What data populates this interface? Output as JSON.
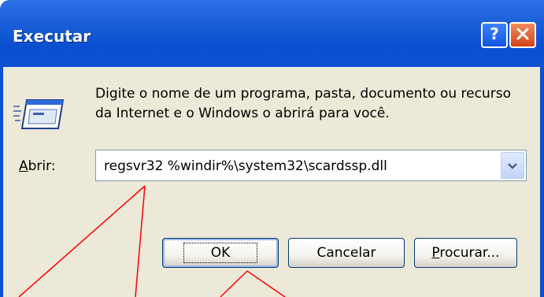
{
  "window": {
    "title": "Executar"
  },
  "dialog": {
    "description": "Digite o nome de um programa, pasta, documento ou recurso da Internet e o Windows o abrirá para você.",
    "open_label_accel": "A",
    "open_label_rest": "brir:",
    "command_value": "regsvr32 %windir%\\system32\\scardssp.dll"
  },
  "buttons": {
    "ok": "OK",
    "cancel": "Cancelar",
    "browse_accel": "P",
    "browse_rest": "rocurar..."
  },
  "icons": {
    "help": "help-icon",
    "close": "close-icon",
    "run": "run-program-icon",
    "dropdown": "chevron-down-icon"
  },
  "colors": {
    "title_bar": "#0a4fcf",
    "client_bg": "#ece9d8",
    "annotation_lines": "#ff0000"
  }
}
